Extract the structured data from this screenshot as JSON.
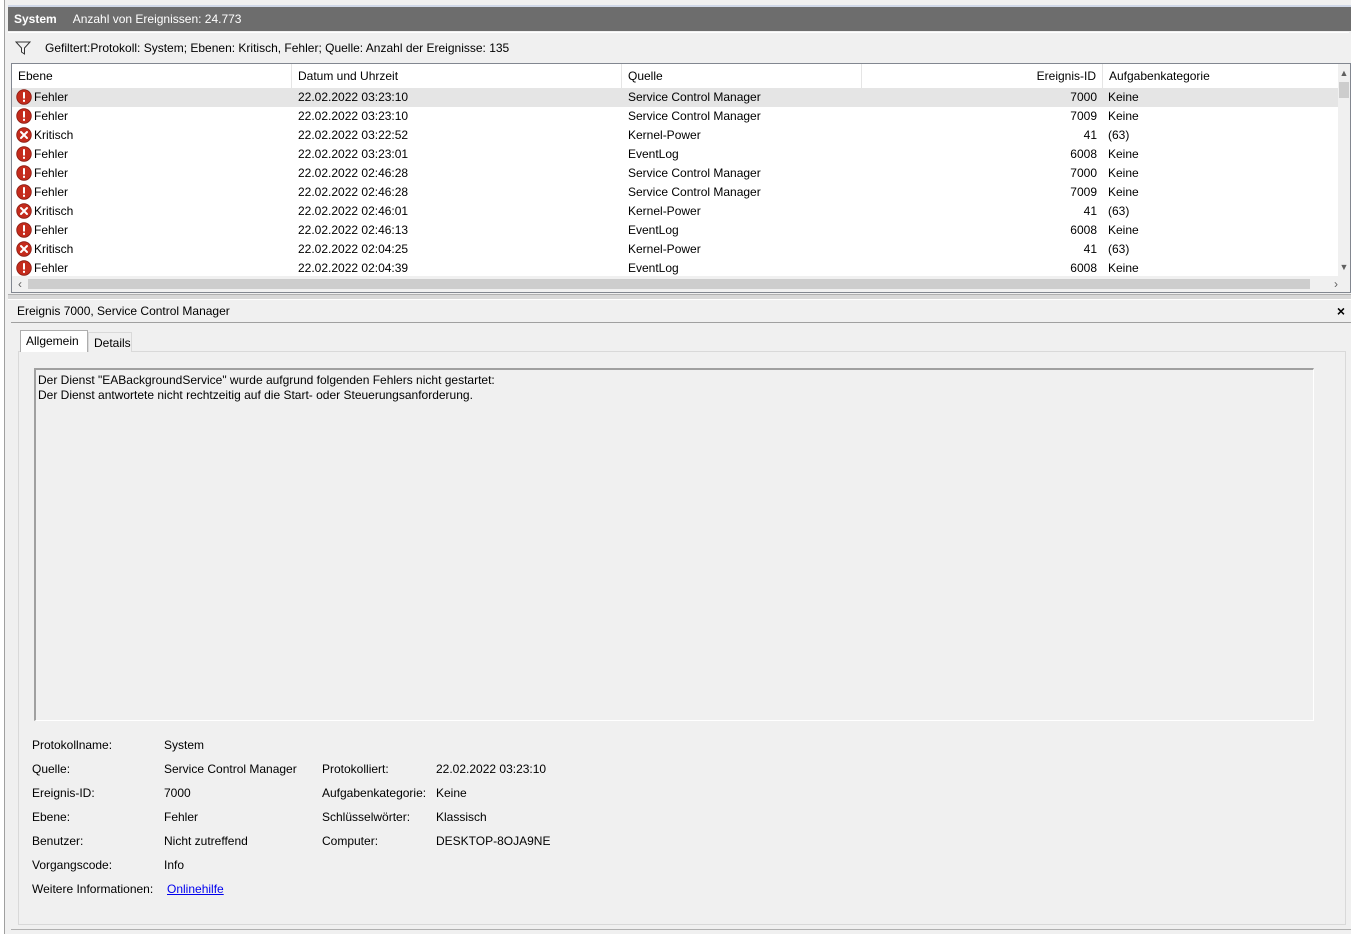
{
  "title": {
    "log_name": "System",
    "event_count": "Anzahl von Ereignissen: 24.773"
  },
  "filter": {
    "icon": "filter-icon",
    "text": "Gefiltert:Protokoll: System; Ebenen: Kritisch, Fehler; Quelle:  Anzahl der Ereignisse: 135"
  },
  "grid": {
    "columns": [
      "Ebene",
      "Datum und Uhrzeit",
      "Quelle",
      "Ereignis-ID",
      "Aufgabenkategorie"
    ],
    "rows": [
      {
        "level": "Fehler",
        "icon": "error-icon",
        "date": "22.02.2022 03:23:10",
        "source": "Service Control Manager",
        "id": "7000",
        "category": "Keine"
      },
      {
        "level": "Fehler",
        "icon": "error-icon",
        "date": "22.02.2022 03:23:10",
        "source": "Service Control Manager",
        "id": "7009",
        "category": "Keine"
      },
      {
        "level": "Kritisch",
        "icon": "critical-icon",
        "date": "22.02.2022 03:22:52",
        "source": "Kernel-Power",
        "id": "41",
        "category": "(63)"
      },
      {
        "level": "Fehler",
        "icon": "error-icon",
        "date": "22.02.2022 03:23:01",
        "source": "EventLog",
        "id": "6008",
        "category": "Keine"
      },
      {
        "level": "Fehler",
        "icon": "error-icon",
        "date": "22.02.2022 02:46:28",
        "source": "Service Control Manager",
        "id": "7000",
        "category": "Keine"
      },
      {
        "level": "Fehler",
        "icon": "error-icon",
        "date": "22.02.2022 02:46:28",
        "source": "Service Control Manager",
        "id": "7009",
        "category": "Keine"
      },
      {
        "level": "Kritisch",
        "icon": "critical-icon",
        "date": "22.02.2022 02:46:01",
        "source": "Kernel-Power",
        "id": "41",
        "category": "(63)"
      },
      {
        "level": "Fehler",
        "icon": "error-icon",
        "date": "22.02.2022 02:46:13",
        "source": "EventLog",
        "id": "6008",
        "category": "Keine"
      },
      {
        "level": "Kritisch",
        "icon": "critical-icon",
        "date": "22.02.2022 02:04:25",
        "source": "Kernel-Power",
        "id": "41",
        "category": "(63)"
      },
      {
        "level": "Fehler",
        "icon": "error-icon",
        "date": "22.02.2022 02:04:39",
        "source": "EventLog",
        "id": "6008",
        "category": "Keine"
      }
    ]
  },
  "detail": {
    "header": "Ereignis 7000, Service Control Manager",
    "close": "×",
    "tabs": [
      "Allgemein",
      "Details"
    ],
    "message": "Der Dienst \"EABackgroundService\" wurde aufgrund folgenden Fehlers nicht gestartet:\nDer Dienst antwortete nicht rechtzeitig auf die Start- oder Steuerungsanforderung.",
    "props": {
      "protokollname_label": "Protokollname:",
      "protokollname": "System",
      "quelle_label": "Quelle:",
      "quelle": "Service Control Manager",
      "protokolliert_label": "Protokolliert:",
      "protokolliert": "22.02.2022 03:23:10",
      "ereignisid_label": "Ereignis-ID:",
      "ereignisid": "7000",
      "aufgabenkategorie_label": "Aufgabenkategorie:",
      "aufgabenkategorie": "Keine",
      "ebene_label": "Ebene:",
      "ebene": "Fehler",
      "schluesselwoerter_label": "Schlüsselwörter:",
      "schluesselwoerter": "Klassisch",
      "benutzer_label": "Benutzer:",
      "benutzer": "Nicht zutreffend",
      "computer_label": "Computer:",
      "computer": "DESKTOP-8OJA9NE",
      "vorgangscode_label": "Vorgangscode:",
      "vorgangscode": "Info",
      "weitere_label": "Weitere Informationen:",
      "weitere_link": "Onlinehilfe"
    }
  },
  "colors": {
    "error": "#c42b1c",
    "critical": "#c42b1c",
    "titlebar": "#6d6d6d",
    "link": "#0000ee"
  }
}
